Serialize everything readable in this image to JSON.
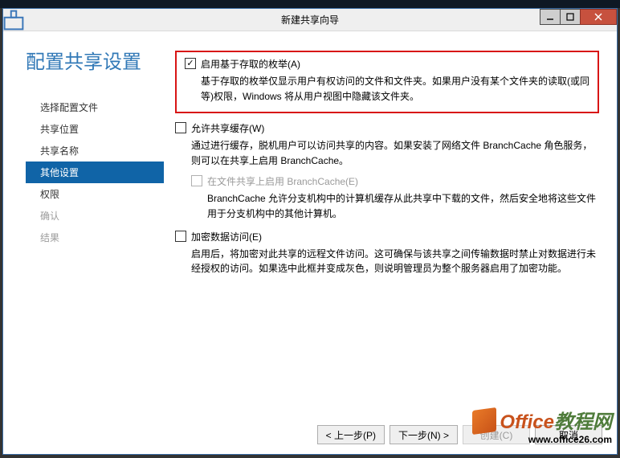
{
  "window": {
    "title": "新建共享向导"
  },
  "heading": "配置共享设置",
  "steps": [
    {
      "label": "选择配置文件",
      "state": "prev"
    },
    {
      "label": "共享位置",
      "state": "prev"
    },
    {
      "label": "共享名称",
      "state": "prev"
    },
    {
      "label": "其他设置",
      "state": "active"
    },
    {
      "label": "权限",
      "state": "next"
    },
    {
      "label": "确认",
      "state": "disabled"
    },
    {
      "label": "结果",
      "state": "disabled"
    }
  ],
  "options": {
    "enum": {
      "label": "启用基于存取的枚举(A)",
      "checked": true,
      "desc": "基于存取的枚举仅显示用户有权访问的文件和文件夹。如果用户没有某个文件夹的读取(或同等)权限，Windows 将从用户视图中隐藏该文件夹。"
    },
    "cache": {
      "label": "允许共享缓存(W)",
      "checked": false,
      "desc": "通过进行缓存，脱机用户可以访问共享的内容。如果安装了网络文件 BranchCache 角色服务，则可以在共享上启用 BranchCache。",
      "sub": {
        "label": "在文件共享上启用 BranchCache(E)",
        "desc": "BranchCache 允许分支机构中的计算机缓存从此共享中下载的文件，然后安全地将这些文件用于分支机构中的其他计算机。"
      }
    },
    "encrypt": {
      "label": "加密数据访问(E)",
      "checked": false,
      "desc": "启用后，将加密对此共享的远程文件访问。这可确保与该共享之间传输数据时禁止对数据进行未经授权的访问。如果选中此框并变成灰色，则说明管理员为整个服务器启用了加密功能。"
    }
  },
  "buttons": {
    "prev": "< 上一步(P)",
    "next": "下一步(N) >",
    "create": "创建(C)",
    "cancel": "取消"
  },
  "watermark": {
    "l1a": "Office",
    "l1b": "教程网",
    "l2": "www.office26.com"
  }
}
